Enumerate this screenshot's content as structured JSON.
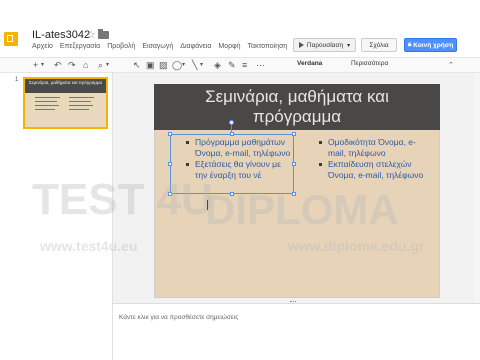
{
  "app": {
    "doc_title": "IL-ates3042",
    "menu": [
      "Αρχείο",
      "Επεξεργασία",
      "Προβολή",
      "Εισαγωγή",
      "Διαφάνεια",
      "Μορφή",
      "Τακτοποίηση"
    ],
    "present_label": "Παρουσίαση",
    "comments_label": "Σχόλια",
    "share_label": "Κοινή χρήση"
  },
  "toolbar": {
    "font": "Verdana",
    "size": "Περισσότερα"
  },
  "filmstrip": {
    "slide_number": "1",
    "thumb_title": "Σεμινάρια, μαθήματα και πρόγραμμα"
  },
  "slide": {
    "title_line1": "Σεμινάρια, μαθήματα και",
    "title_line2": "πρόγραμμα",
    "left_items": [
      "Πρόγραμμα μαθημάτων Όνομα, e-mail, τηλέφωνο",
      "Εξετάσεις θα γίνουν με την έναρξη του νέ"
    ],
    "right_items": [
      "Ομοδικότητα Όνομα, e-mail, τηλέφωνο",
      "Εκπαίδευση στελεχών Όνομα, e-mail, τηλέφωνο"
    ]
  },
  "notes": {
    "placeholder": "Κάντε κλικ για να προσθέσετε σημειώσεις"
  },
  "watermark": {
    "brand1": "TEST 4U",
    "brand2": "DIPLOMA",
    "url1": "www.test4u.eu",
    "url2": "www.diploma.edu.gr"
  }
}
